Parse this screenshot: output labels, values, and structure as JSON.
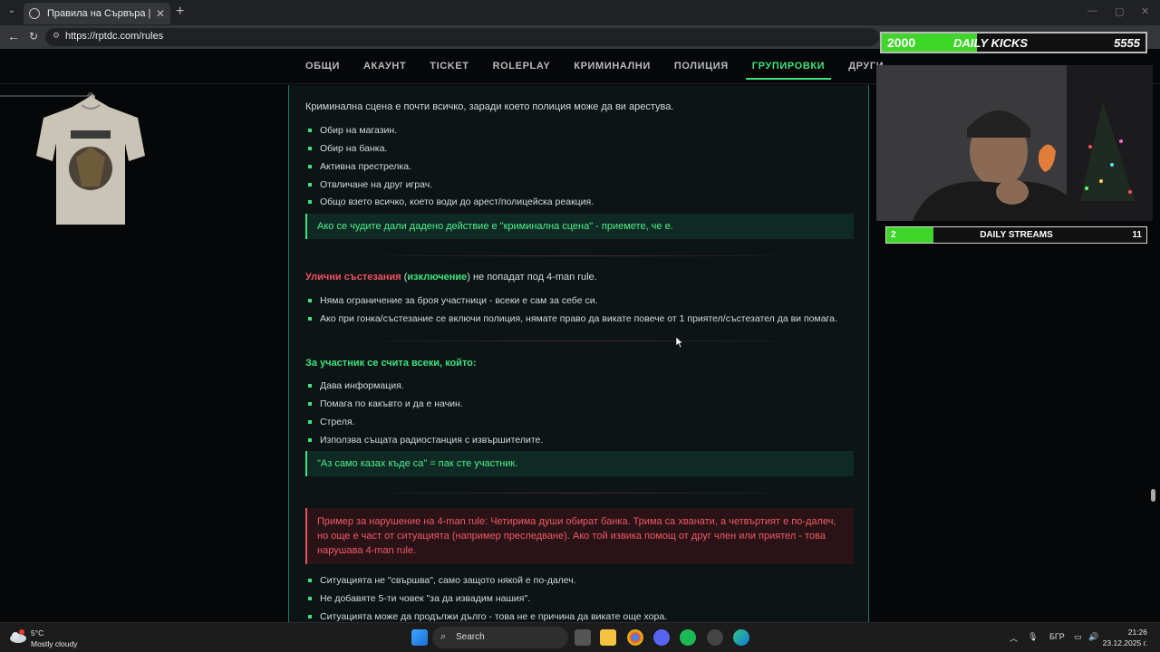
{
  "browser": {
    "tab_title": "Правила на Сървъра | TDC Rolep",
    "tab_close": "✕",
    "new_tab": "+",
    "url": "https://rptdc.com/rules"
  },
  "site_nav": {
    "items": [
      "ОБЩИ",
      "АКАУНТ",
      "TICKET",
      "ROLEPLAY",
      "КРИМИНАЛНИ",
      "ПОЛИЦИЯ",
      "ГРУПИРОВКИ",
      "ДРУГИ"
    ],
    "active": "ГРУПИРОВКИ"
  },
  "content": {
    "intro": "Криминална сцена е почти всичко, заради което полиция може да ви арестува.",
    "crime_list": [
      "Обир на магазин.",
      "Обир на банка.",
      "Активна престрелка.",
      "Отвличане на друг играч.",
      "Общо взето всичко, което води до арест/полицейска реакция."
    ],
    "note1": "Ако се чудите дали дадено действие е \"криминална сцена\" - приемете, че е.",
    "race_red": "Улични състезания",
    "race_open": " (",
    "race_exc": "изключение",
    "race_close": ") не попадат под 4-man rule.",
    "race_list": [
      "Няма ограничение за броя участници - всеки е сам за себе си.",
      "Ако при гонка/състезание се включи полиция, нямате право да викате повече от 1 приятел/състезател да ви помага."
    ],
    "participant_heading": "За участник се счита всеки, който:",
    "participant_list": [
      "Дава информация.",
      "Помага по какъвто и да е начин.",
      "Стреля.",
      "Използва същата радиостанция с извършителите."
    ],
    "note2": "\"Аз само казах къде са\" = пак сте участник.",
    "warning": "Пример за нарушение на 4-man rule: Четирима души обират банка. Трима са хванати, а четвъртият е по-далеч, но още е част от ситуацията (например преследване). Ако той извика помощ от друг член или приятел - това нарушава 4-man rule.",
    "final_list": [
      "Ситуацията не \"свършва\", само защото някой е по-далеч.",
      "Не добавяте 5-ти човек \"за да извадим нашия\".",
      "Ситуацията може да продължи дълго - това не е причина да викате още хора."
    ]
  },
  "overlay": {
    "kicks_current": "2000",
    "kicks_label": "DAILY KICKS",
    "kicks_goal": "5555",
    "kicks_progress": 0.36,
    "streams_current": "2",
    "streams_label": "DAILY STREAMS",
    "streams_goal": "11",
    "streams_progress": 0.18
  },
  "taskbar": {
    "temp": "5°C",
    "condition": "Mostly cloudy",
    "search_label": "Search",
    "lang": "БГР",
    "time": "21:26",
    "date": "23.12.2025 г."
  },
  "colors": {
    "accent": "#3ee37c",
    "danger": "#f0535f"
  }
}
